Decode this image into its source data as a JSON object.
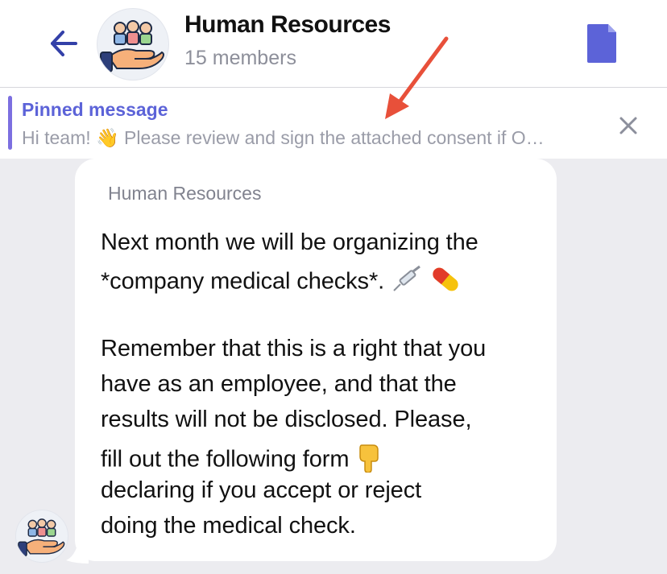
{
  "header": {
    "title": "Human Resources",
    "subtitle": "15 members",
    "back_icon": "arrow-left-icon",
    "document_icon": "document-icon",
    "accent_color": "#5c63d8"
  },
  "pinned": {
    "title": "Pinned message",
    "text": "Hi team! 👋 Please review and sign the attached consent if O…",
    "close_icon": "close-icon"
  },
  "message": {
    "sender": "Human Resources",
    "lines": [
      "Next month we will be organizing the",
      "*company medical checks*.",
      "",
      "Remember that this is a right that you",
      "have as an employee, and that the",
      "results will not be disclosed. Please,",
      "fill out the following form",
      "declaring if you accept or reject",
      "doing the medical check."
    ]
  },
  "annotation_color": "#e8503a"
}
